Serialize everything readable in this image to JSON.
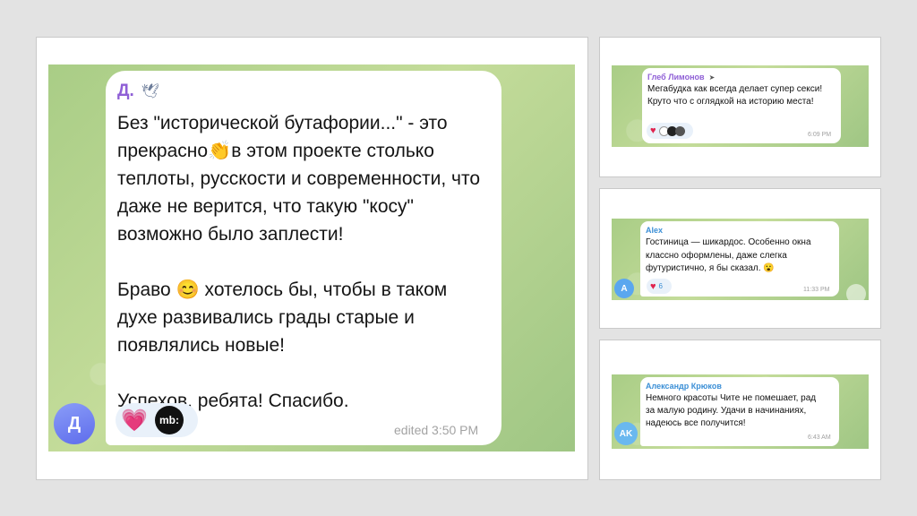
{
  "main_post": {
    "author": "Д.",
    "avatar_letter": "Д",
    "paragraphs": [
      "Без \"исторической бутафории...\" - это прекрасно👏в этом проекте столько теплоты, русскости и современности, что даже не верится, что такую \"косу\" возможно было заплести!",
      "Браво 😊 хотелось бы, чтобы в таком духе развивались грады старые и появлялись новые!",
      "Успехов, ребята! Спасибо."
    ],
    "reaction_badge": "mb:",
    "time": "edited 3:50 PM"
  },
  "comments": [
    {
      "author": "Глеб Лимонов",
      "text": "Мегабудка как всегда делает супер секси! Круто что с оглядкой на историю места!",
      "time": "6:09 PM",
      "reaction_count": ""
    },
    {
      "author": "Alex",
      "avatar_letter": "A",
      "text": "Гостиница — шикардос. Особенно окна классно оформлены, даже слегка футуристично, я бы сказал. 😮",
      "time": "11:33 PM",
      "reaction_count": "6"
    },
    {
      "author": "Александр Крюков",
      "avatar_letter": "AK",
      "text": "Немного красоты Чите не помешает, рад за малую родину. Удачи в начинаниях, надеюсь все получится!",
      "time": "6:43 AM"
    }
  ],
  "colors": {
    "author_main": "#8f5fd6",
    "author_gleb": "#8f5fd6",
    "author_alex": "#3b8fd6",
    "author_kryukov": "#3b8fd6",
    "avatar_main": "#6f7bf0",
    "avatar_alex": "#5aa7ef",
    "avatar_kryukov": "#6ab8ef"
  }
}
